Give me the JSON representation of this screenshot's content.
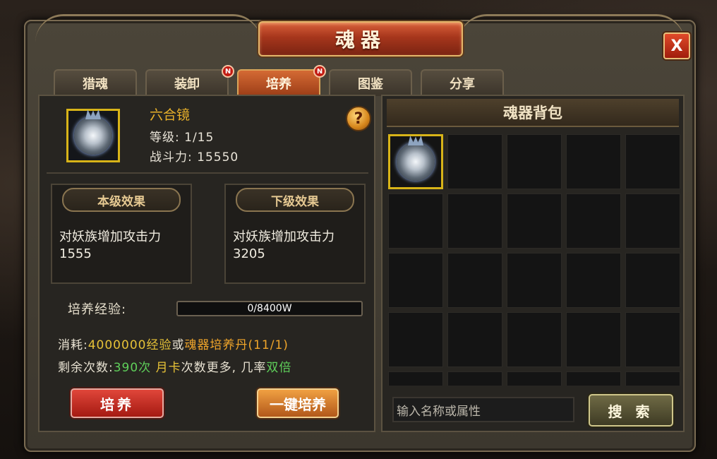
{
  "window": {
    "title": "魂器",
    "close_label": "X"
  },
  "tabs": [
    {
      "label": "猎魂",
      "badge": ""
    },
    {
      "label": "装卸",
      "badge": "N"
    },
    {
      "label": "培养",
      "badge": "N",
      "active": true
    },
    {
      "label": "图鉴",
      "badge": ""
    },
    {
      "label": "分享",
      "badge": ""
    }
  ],
  "item": {
    "name": "六合镜",
    "level_line": "等级: 1/15",
    "power_line": "战斗力: 15550",
    "help_label": "?"
  },
  "effects": {
    "current": {
      "title": "本级效果",
      "line1": "对妖族增加攻击力",
      "line2": "1555"
    },
    "next": {
      "title": "下级效果",
      "line1": "对妖族增加攻击力",
      "line2": "3205"
    }
  },
  "experience": {
    "label": "培养经验:",
    "value": "0/8400W",
    "progress": 0
  },
  "cost": {
    "prefix": "消耗:",
    "exp": "4000000经验",
    "or": "或",
    "item": "魂器培养丹",
    "count": "(11/1)"
  },
  "remaining": {
    "prefix": "剩余次数:",
    "count": "390次",
    "monthly": "月卡",
    "middle": "次数更多, 几率",
    "double": "双倍"
  },
  "buttons": {
    "cultivate": "培养",
    "one_click": "一键培养",
    "search": "搜 索"
  },
  "bag": {
    "title": "魂器背包",
    "search_placeholder": "输入名称或属性"
  },
  "colors": {
    "accent_gold": "#d8b418",
    "title_red": "#a6361c",
    "green": "#5fd05a"
  }
}
